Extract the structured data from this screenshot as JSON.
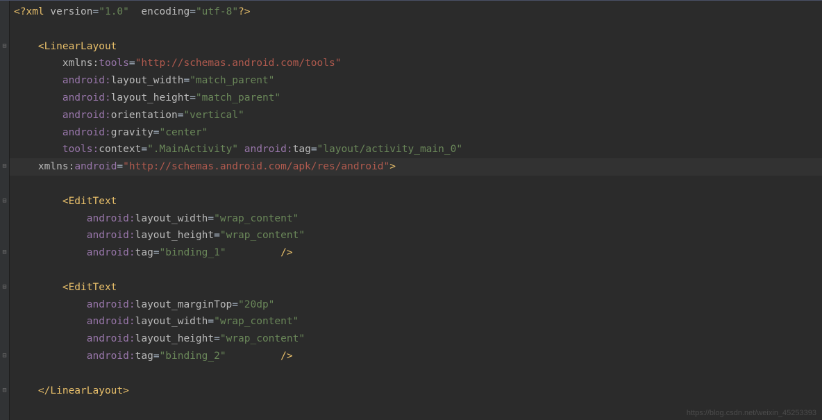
{
  "code": {
    "lines": [
      {
        "indent": 0,
        "type": "xml_decl",
        "tokens": [
          {
            "t": "<?",
            "c": "c-tag"
          },
          {
            "t": "xml ",
            "c": "c-tag"
          },
          {
            "t": "version",
            "c": "c-attr"
          },
          {
            "t": "=",
            "c": "c-punct"
          },
          {
            "t": "\"1.0\"",
            "c": "c-str"
          },
          {
            "t": "  ",
            "c": "c-default"
          },
          {
            "t": "encoding",
            "c": "c-attr"
          },
          {
            "t": "=",
            "c": "c-punct"
          },
          {
            "t": "\"utf-8\"",
            "c": "c-str"
          },
          {
            "t": "?>",
            "c": "c-tag"
          }
        ]
      },
      {
        "indent": 0,
        "type": "blank",
        "tokens": []
      },
      {
        "indent": 1,
        "type": "open_tag",
        "tokens": [
          {
            "t": "<LinearLayout",
            "c": "c-tag"
          }
        ]
      },
      {
        "indent": 2,
        "type": "attr",
        "tokens": [
          {
            "t": "xmlns:",
            "c": "c-attr"
          },
          {
            "t": "tools",
            "c": "c-ns"
          },
          {
            "t": "=",
            "c": "c-punct"
          },
          {
            "t": "\"http://schemas.android.com/tools\"",
            "c": "c-str-url"
          }
        ]
      },
      {
        "indent": 2,
        "type": "attr",
        "tokens": [
          {
            "t": "android:",
            "c": "c-ns"
          },
          {
            "t": "layout_width",
            "c": "c-attr"
          },
          {
            "t": "=",
            "c": "c-punct"
          },
          {
            "t": "\"match_parent\"",
            "c": "c-str"
          }
        ]
      },
      {
        "indent": 2,
        "type": "attr",
        "tokens": [
          {
            "t": "android:",
            "c": "c-ns"
          },
          {
            "t": "layout_height",
            "c": "c-attr"
          },
          {
            "t": "=",
            "c": "c-punct"
          },
          {
            "t": "\"match_parent\"",
            "c": "c-str"
          }
        ]
      },
      {
        "indent": 2,
        "type": "attr",
        "tokens": [
          {
            "t": "android:",
            "c": "c-ns"
          },
          {
            "t": "orientation",
            "c": "c-attr"
          },
          {
            "t": "=",
            "c": "c-punct"
          },
          {
            "t": "\"vertical\"",
            "c": "c-str"
          }
        ]
      },
      {
        "indent": 2,
        "type": "attr",
        "tokens": [
          {
            "t": "android:",
            "c": "c-ns"
          },
          {
            "t": "gravity",
            "c": "c-attr"
          },
          {
            "t": "=",
            "c": "c-punct"
          },
          {
            "t": "\"center\"",
            "c": "c-str"
          }
        ]
      },
      {
        "indent": 2,
        "type": "attr",
        "tokens": [
          {
            "t": "tools:",
            "c": "c-ns"
          },
          {
            "t": "context",
            "c": "c-attr"
          },
          {
            "t": "=",
            "c": "c-punct"
          },
          {
            "t": "\".MainActivity\"",
            "c": "c-str"
          },
          {
            "t": " ",
            "c": "c-default"
          },
          {
            "t": "android:",
            "c": "c-ns"
          },
          {
            "t": "tag",
            "c": "c-attr"
          },
          {
            "t": "=",
            "c": "c-punct"
          },
          {
            "t": "\"layout/activity_main_0\"",
            "c": "c-str"
          }
        ]
      },
      {
        "indent": 1,
        "type": "attr",
        "hl": true,
        "tokens": [
          {
            "t": "xmlns:",
            "c": "c-attr"
          },
          {
            "t": "android",
            "c": "c-ns"
          },
          {
            "t": "=",
            "c": "c-punct"
          },
          {
            "t": "\"http://schemas.android.com/apk/res/android\"",
            "c": "c-str-url"
          },
          {
            "t": ">",
            "c": "c-tag"
          }
        ]
      },
      {
        "indent": 0,
        "type": "blank",
        "tokens": []
      },
      {
        "indent": 2,
        "type": "open_tag",
        "tokens": [
          {
            "t": "<EditText",
            "c": "c-tag"
          }
        ]
      },
      {
        "indent": 3,
        "type": "attr",
        "tokens": [
          {
            "t": "android:",
            "c": "c-ns"
          },
          {
            "t": "layout_width",
            "c": "c-attr"
          },
          {
            "t": "=",
            "c": "c-punct"
          },
          {
            "t": "\"wrap_content\"",
            "c": "c-str"
          }
        ]
      },
      {
        "indent": 3,
        "type": "attr",
        "tokens": [
          {
            "t": "android:",
            "c": "c-ns"
          },
          {
            "t": "layout_height",
            "c": "c-attr"
          },
          {
            "t": "=",
            "c": "c-punct"
          },
          {
            "t": "\"wrap_content\"",
            "c": "c-str"
          }
        ]
      },
      {
        "indent": 3,
        "type": "attr",
        "tokens": [
          {
            "t": "android:",
            "c": "c-ns"
          },
          {
            "t": "tag",
            "c": "c-attr"
          },
          {
            "t": "=",
            "c": "c-punct"
          },
          {
            "t": "\"binding_1\"",
            "c": "c-str"
          },
          {
            "t": "         ",
            "c": "c-default"
          },
          {
            "t": "/>",
            "c": "c-tag"
          }
        ]
      },
      {
        "indent": 0,
        "type": "blank",
        "tokens": []
      },
      {
        "indent": 2,
        "type": "open_tag",
        "tokens": [
          {
            "t": "<EditText",
            "c": "c-tag"
          }
        ]
      },
      {
        "indent": 3,
        "type": "attr",
        "tokens": [
          {
            "t": "android:",
            "c": "c-ns"
          },
          {
            "t": "layout_marginTop",
            "c": "c-attr"
          },
          {
            "t": "=",
            "c": "c-punct"
          },
          {
            "t": "\"20dp\"",
            "c": "c-str"
          }
        ]
      },
      {
        "indent": 3,
        "type": "attr",
        "tokens": [
          {
            "t": "android:",
            "c": "c-ns"
          },
          {
            "t": "layout_width",
            "c": "c-attr"
          },
          {
            "t": "=",
            "c": "c-punct"
          },
          {
            "t": "\"wrap_content\"",
            "c": "c-str"
          }
        ]
      },
      {
        "indent": 3,
        "type": "attr",
        "tokens": [
          {
            "t": "android:",
            "c": "c-ns"
          },
          {
            "t": "layout_height",
            "c": "c-attr"
          },
          {
            "t": "=",
            "c": "c-punct"
          },
          {
            "t": "\"wrap_content\"",
            "c": "c-str"
          }
        ]
      },
      {
        "indent": 3,
        "type": "attr",
        "tokens": [
          {
            "t": "android:",
            "c": "c-ns"
          },
          {
            "t": "tag",
            "c": "c-attr"
          },
          {
            "t": "=",
            "c": "c-punct"
          },
          {
            "t": "\"binding_2\"",
            "c": "c-str"
          },
          {
            "t": "         ",
            "c": "c-default"
          },
          {
            "t": "/>",
            "c": "c-tag"
          }
        ]
      },
      {
        "indent": 0,
        "type": "blank",
        "tokens": []
      },
      {
        "indent": 1,
        "type": "close_tag",
        "tokens": [
          {
            "t": "</LinearLayout>",
            "c": "c-tag"
          }
        ]
      }
    ]
  },
  "folds": [
    {
      "line": 2,
      "glyph": "⊟"
    },
    {
      "line": 9,
      "glyph": "⊟"
    },
    {
      "line": 11,
      "glyph": "⊟"
    },
    {
      "line": 14,
      "glyph": "⊟"
    },
    {
      "line": 16,
      "glyph": "⊟"
    },
    {
      "line": 20,
      "glyph": "⊟"
    },
    {
      "line": 22,
      "glyph": "⊟"
    }
  ],
  "watermark": "https://blog.csdn.net/weixin_45253393",
  "indent_unit": "    "
}
